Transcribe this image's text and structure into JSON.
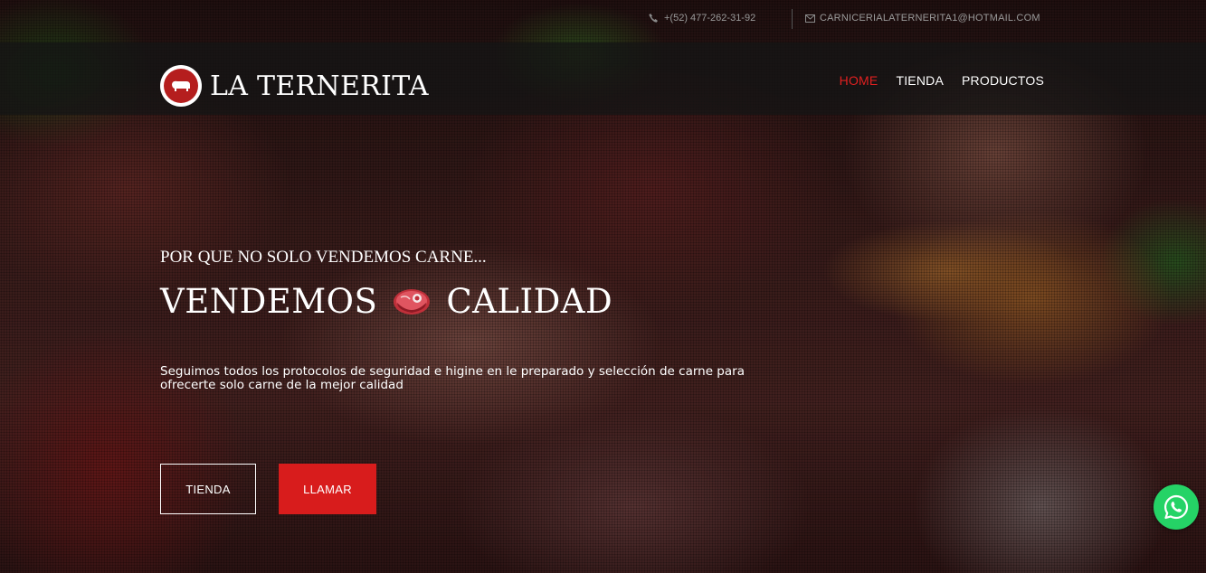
{
  "topbar": {
    "phone": "+(52) 477-262-31-92",
    "email": "CARNICERIALATERNERITA1@HOTMAIL.COM",
    "phone_icon": "phone-icon",
    "email_icon": "envelope-icon"
  },
  "navbar": {
    "brand": "LA TERNERITA",
    "logo_text": "LA TERNERITA",
    "items": [
      {
        "label": "HOME",
        "active": true
      },
      {
        "label": "TIENDA",
        "active": false
      },
      {
        "label": "PRODUCTOS",
        "active": false
      }
    ]
  },
  "hero": {
    "kicker": "POR QUE NO SOLO VENDEMOS CARNE...",
    "headline_left": "VENDEMOS",
    "headline_icon": "meat-icon",
    "headline_right": "CALIDAD",
    "description": "Seguimos todos los protocolos de seguridad e higine en le preparado y selección de carne para ofrecerte solo carne de la mejor calidad",
    "button_primary": "TIENDA",
    "button_secondary": "LLAMAR"
  },
  "floating": {
    "whatsapp_icon": "whatsapp-icon"
  },
  "colors": {
    "accent": "#d81c1c",
    "nav_active": "#e02020",
    "whatsapp": "#25d366"
  }
}
